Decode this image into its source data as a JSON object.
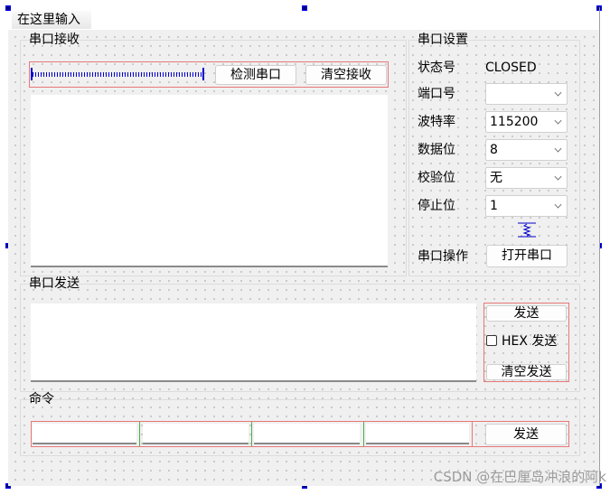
{
  "menu": {
    "placeholder_tab": "在这里输入"
  },
  "receive_group": {
    "title": "串口接收",
    "detect_button": "检测串口",
    "clear_button": "清空接收",
    "receive_text": ""
  },
  "settings_group": {
    "title": "串口设置",
    "status_label": "状态号",
    "status_value": "CLOSED",
    "port_label": "端口号",
    "port_value": "",
    "baud_label": "波特率",
    "baud_value": "115200",
    "databits_label": "数据位",
    "databits_value": "8",
    "parity_label": "校验位",
    "parity_value": "无",
    "stopbits_label": "停止位",
    "stopbits_value": "1",
    "operation_label": "串口操作",
    "open_button": "打开串口"
  },
  "send_group": {
    "title": "串口发送",
    "send_text": "",
    "send_button": "发送",
    "hex_checkbox_label": "HEX 发送",
    "hex_checked": false,
    "clear_button": "清空发送"
  },
  "command_group": {
    "title": "命令",
    "inputs": [
      "",
      "",
      "",
      ""
    ],
    "send_button": "发送"
  },
  "watermark": "CSDN @在巴厘岛冲浪的阿k",
  "colors": {
    "layout_box": "#e87878",
    "spacer": "#0000cc",
    "handle": "#000080"
  }
}
